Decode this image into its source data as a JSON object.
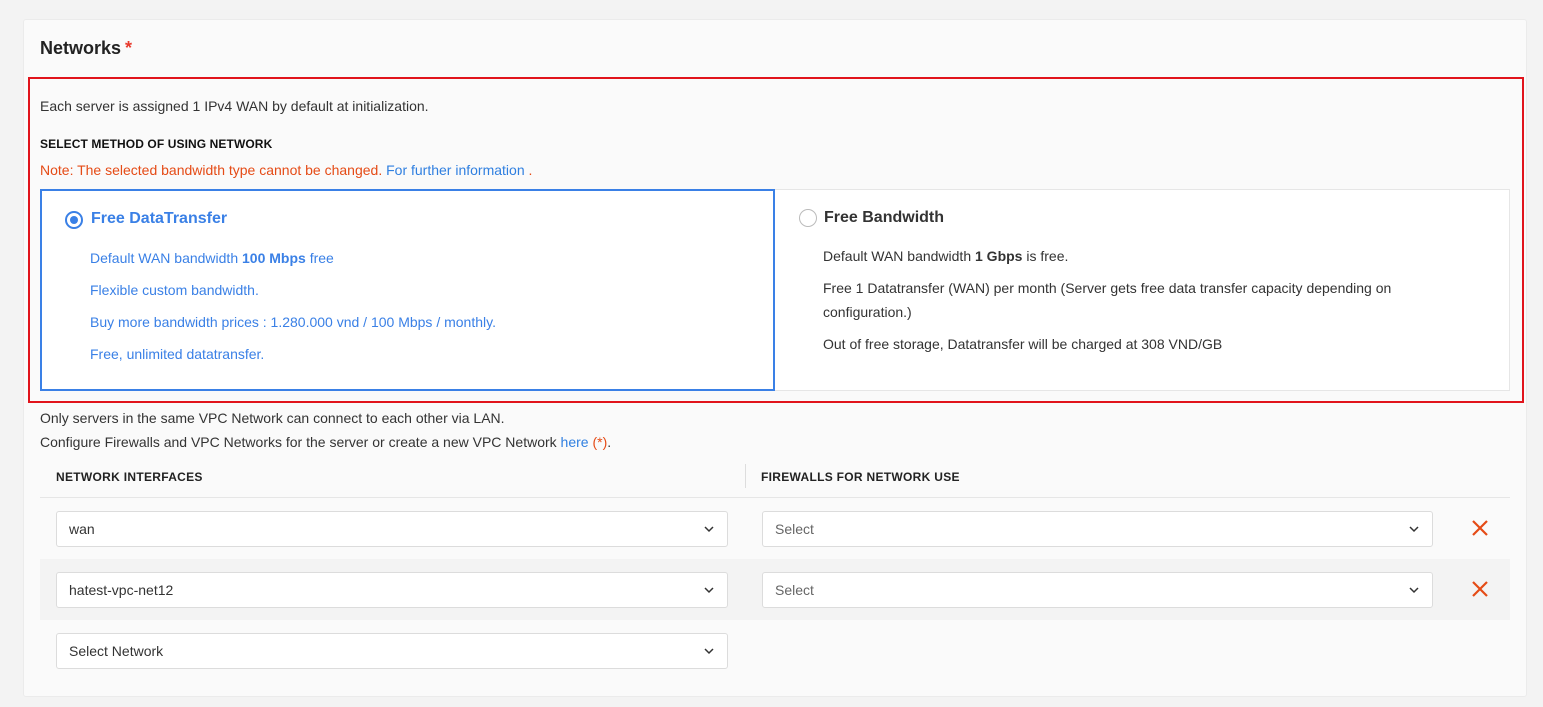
{
  "section": {
    "title": "Networks",
    "required_mark": "*"
  },
  "intro": "Each server is assigned 1 IPv4 WAN by default at initialization.",
  "method_label": "SELECT METHOD OF USING NETWORK",
  "note": {
    "text": "Note: The selected bandwidth type cannot be changed.",
    "link": "For further information",
    "suffix": "."
  },
  "options": [
    {
      "title": "Free DataTransfer",
      "selected": true,
      "lines": [
        {
          "pre": "Default WAN bandwidth ",
          "bold": "100 Mbps",
          "post": " free"
        },
        {
          "pre": "Flexible custom bandwidth.",
          "bold": "",
          "post": ""
        },
        {
          "pre": "Buy more bandwidth prices : 1.280.000 vnd / 100 Mbps / monthly.",
          "bold": "",
          "post": ""
        },
        {
          "pre": "Free, unlimited datatransfer.",
          "bold": "",
          "post": ""
        }
      ]
    },
    {
      "title": "Free Bandwidth",
      "selected": false,
      "lines": [
        {
          "pre": "Default WAN bandwidth ",
          "bold": "1 Gbps",
          "post": " is free."
        },
        {
          "pre": "Free 1 Datatransfer (WAN) per month (Server gets free data transfer capacity depending on configuration.)",
          "bold": "",
          "post": ""
        },
        {
          "pre": "Out of free storage, Datatransfer will be charged at 308 VND/GB",
          "bold": "",
          "post": ""
        }
      ]
    }
  ],
  "info": {
    "line1": "Only servers in the same VPC Network can connect to each other via LAN.",
    "line2": "Configure Firewalls and VPC Networks for the server or create a new VPC Network ",
    "link": "here",
    "mark": "(*)",
    "end": "."
  },
  "table": {
    "headers": [
      "NETWORK INTERFACES",
      "FIREWALLS FOR NETWORK USE"
    ],
    "rows": [
      {
        "network": "wan",
        "firewall_placeholder": "Select"
      },
      {
        "network": "hatest-vpc-net12",
        "firewall_placeholder": "Select"
      }
    ],
    "add_placeholder": "Select Network"
  },
  "colors": {
    "accent": "#3a80e6",
    "danger": "#e54b16",
    "highlight": "#e1141c"
  },
  "icons": {
    "dropdown": "chevron-down-icon",
    "delete": "close-icon"
  }
}
